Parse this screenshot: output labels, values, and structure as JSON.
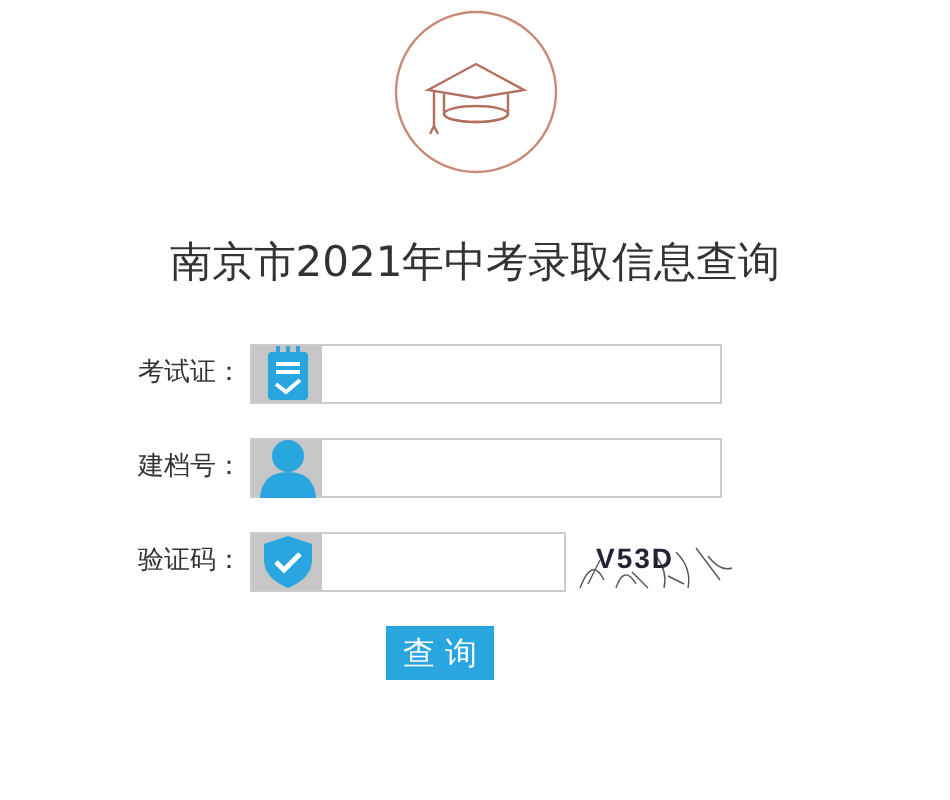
{
  "title": "南京市2021年中考录取信息查询",
  "fields": [
    {
      "label": "考试证：",
      "kind": "card"
    },
    {
      "label": "建档号：",
      "kind": "user"
    },
    {
      "label": "验证码：",
      "kind": "captcha"
    }
  ],
  "captcha": {
    "text": "V53D"
  },
  "submit_button": "查 询"
}
